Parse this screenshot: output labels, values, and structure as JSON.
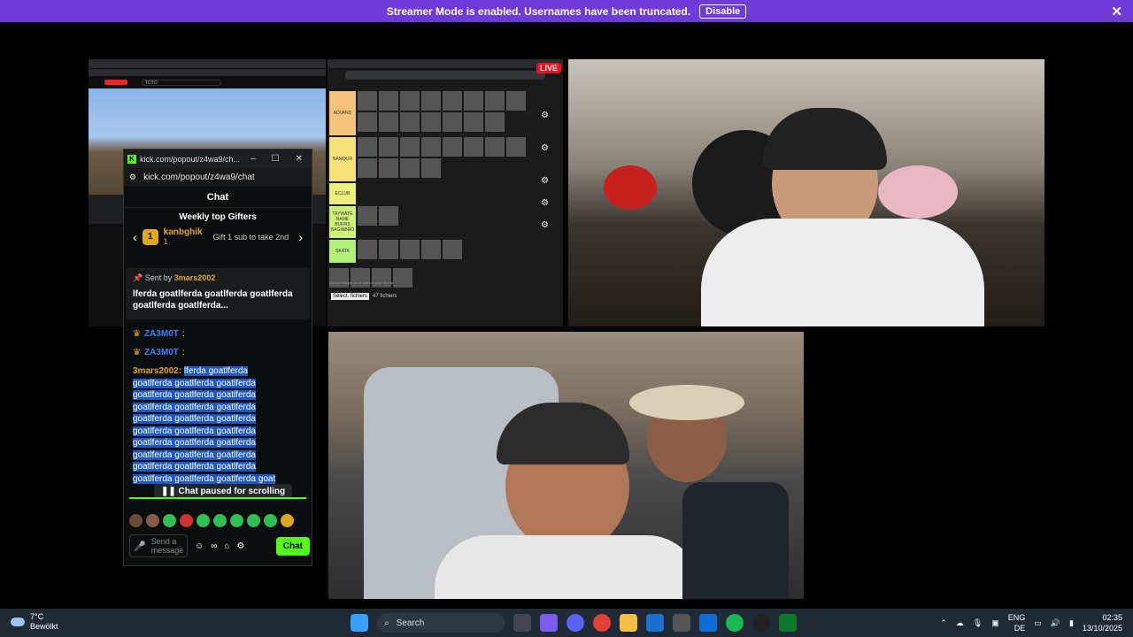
{
  "banner": {
    "text": "Streamer Mode is enabled. Usernames have been truncated.",
    "button": "Disable",
    "close": "✕"
  },
  "stream": {
    "live_badge": "LIVE",
    "youtube_search": "TOTO",
    "tier_rows": [
      "ADVAND",
      "NAMOUR",
      "ECLUB",
      "TAYWAYE NAME BURNS BAGINBRO",
      "SKATA"
    ],
    "tier_footer": "Upload images to be used in your tier list",
    "tier_button": "Sélect. fichiers",
    "tier_file_count": "47 fichiers"
  },
  "chat_window": {
    "title": "kick.com/popout/z4wa9/ch...",
    "url": "kick.com/popout/z4wa9/chat",
    "header": "Chat",
    "gifters_title": "Weekly top Gifters",
    "gifter_rank": "1",
    "gifter_name": "kanbghik",
    "gifter_count": "1",
    "gifter_sub": "Gift 1 sub to take 2nd",
    "pinned_by_label": "Sent by",
    "pinned_by_user": "3mars2002",
    "pinned_message": "lferda goatlferda goatlferda goatlferda goatlferda goatlferda...",
    "messages": [
      {
        "user": "ZA3M0T",
        "text": ":"
      },
      {
        "user": "ZA3M0T",
        "text": ":"
      }
    ],
    "long_user": "3mars2002:",
    "long_message": "lferda goatlferda goatlferda goatlferda goatlferda goatlferda goatlferda goatlferda goatlferda goatlferda goatlferda goatlferda goatlferda goatlferda goatlferda goatlferda goatlferda goatlferda goatlferda goatlferda goatlferda goatlferda goatlferda goatlferda goatlferda goatlferda goatlferda goatlferda goatlferda goat",
    "paused_text": "Chat paused for scrolling",
    "input_placeholder": "Send a message",
    "chat_button": "Chat"
  },
  "taskbar": {
    "temperature": "7°C",
    "weather": "Bewölkt",
    "search": "Search",
    "language_top": "ENG",
    "language_bottom": "DE",
    "time": "02:35",
    "date": "13/10/2025"
  }
}
